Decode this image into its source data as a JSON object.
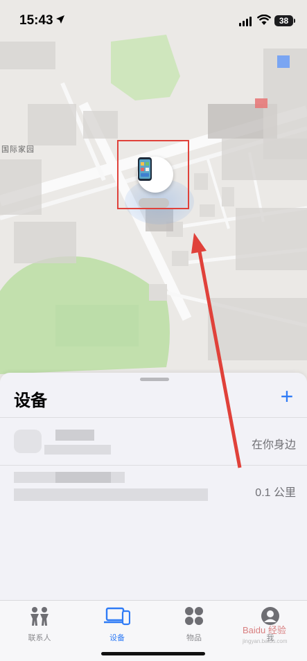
{
  "status_bar": {
    "time": "15:43",
    "battery": "38"
  },
  "map": {
    "labels": [
      "国际家园"
    ]
  },
  "sheet": {
    "title": "设备",
    "add_label": "+",
    "devices": [
      {
        "status": "在你身边"
      },
      {
        "status": "0.1 公里"
      }
    ]
  },
  "tabs": [
    {
      "label": "联系人",
      "icon": "people-icon"
    },
    {
      "label": "设备",
      "icon": "devices-icon"
    },
    {
      "label": "物品",
      "icon": "items-icon"
    },
    {
      "label": "我",
      "icon": "person-icon"
    }
  ],
  "active_tab": "设备",
  "watermark": {
    "text": "Baidu 经验",
    "sub": "jingyan.baidu.com"
  },
  "colors": {
    "accent": "#2f7bf6",
    "annotation": "#e0413a"
  }
}
